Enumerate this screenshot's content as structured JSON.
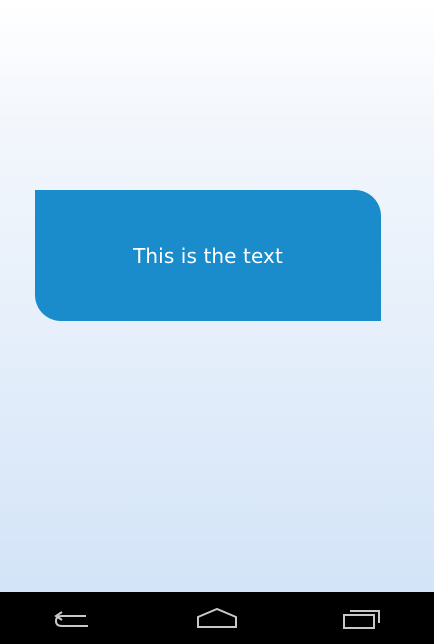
{
  "bubble": {
    "text": "This is the text",
    "color": "#1a8ccc"
  },
  "navbar": {
    "buttons": [
      {
        "name": "back-icon"
      },
      {
        "name": "home-icon"
      },
      {
        "name": "recent-apps-icon"
      }
    ]
  }
}
